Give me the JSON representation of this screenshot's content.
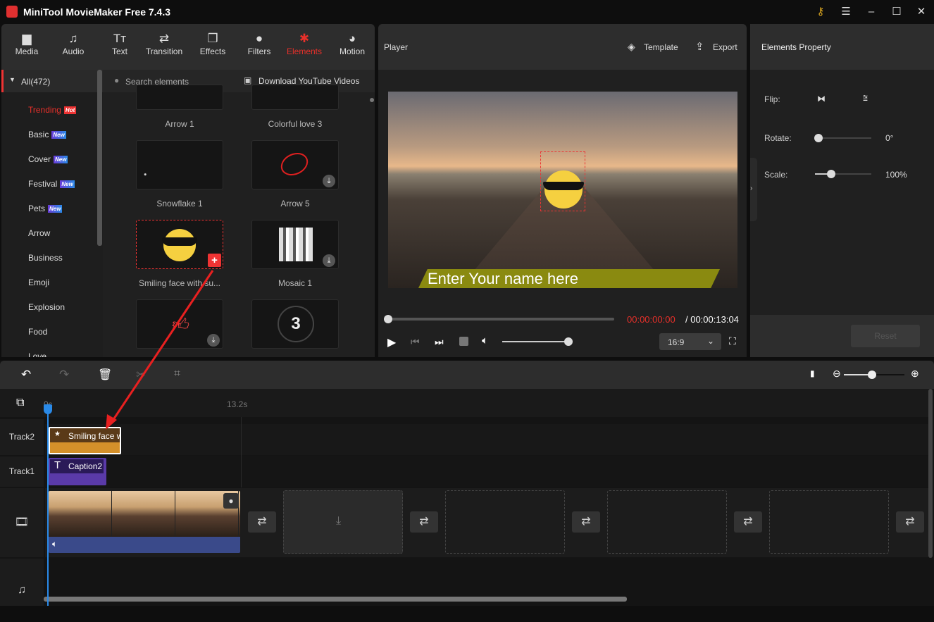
{
  "app": {
    "title": "MiniTool MovieMaker Free 7.4.3",
    "accent": "#e8302a"
  },
  "toolbar": [
    {
      "label": "Media",
      "icon": "folder-icon"
    },
    {
      "label": "Audio",
      "icon": "music-note-icon"
    },
    {
      "label": "Text",
      "icon": "text-icon"
    },
    {
      "label": "Transition",
      "icon": "transition-icon"
    },
    {
      "label": "Effects",
      "icon": "effects-icon"
    },
    {
      "label": "Filters",
      "icon": "filters-icon"
    },
    {
      "label": "Elements",
      "icon": "elements-icon",
      "active": true
    },
    {
      "label": "Motion",
      "icon": "motion-icon"
    }
  ],
  "sidebar": {
    "all": "All(472)",
    "items": [
      {
        "label": "Trending",
        "badge": "Hot"
      },
      {
        "label": "Basic",
        "badge": "New"
      },
      {
        "label": "Cover",
        "badge": "New"
      },
      {
        "label": "Festival",
        "badge": "New"
      },
      {
        "label": "Pets",
        "badge": "New"
      },
      {
        "label": "Arrow"
      },
      {
        "label": "Business"
      },
      {
        "label": "Emoji"
      },
      {
        "label": "Explosion"
      },
      {
        "label": "Food"
      },
      {
        "label": "Love"
      }
    ]
  },
  "search": {
    "placeholder": "Search elements",
    "download": "Download YouTube Videos"
  },
  "elements": [
    "Arrow 1",
    "Colorful love 3",
    "Snowflake 1",
    "Arrow 5",
    "Smiling face with su...",
    "Mosaic 1"
  ],
  "countdown": "3",
  "player": {
    "title": "Player",
    "template": "Template",
    "export": "Export",
    "caption": "Enter Your name here",
    "current_time": "00:00:00:00",
    "total_time": "/ 00:00:13:04",
    "aspect": "16:9",
    "volume": 1.0,
    "progress": 0
  },
  "properties": {
    "title": "Elements Property",
    "flip": "Flip:",
    "rotate": "Rotate:",
    "rotate_value": "0°",
    "scale": "Scale:",
    "scale_value": "100%",
    "reset": "Reset",
    "scale_fraction": 0.3,
    "rotate_fraction": 0
  },
  "timeline": {
    "ruler_start": "0s",
    "ruler_mark": "13.2s",
    "tracks": [
      "Track2",
      "Track1"
    ],
    "clip_element": "Smiling face with sunglasses",
    "clip_caption": "Caption2",
    "zoom_fraction": 0.45
  }
}
